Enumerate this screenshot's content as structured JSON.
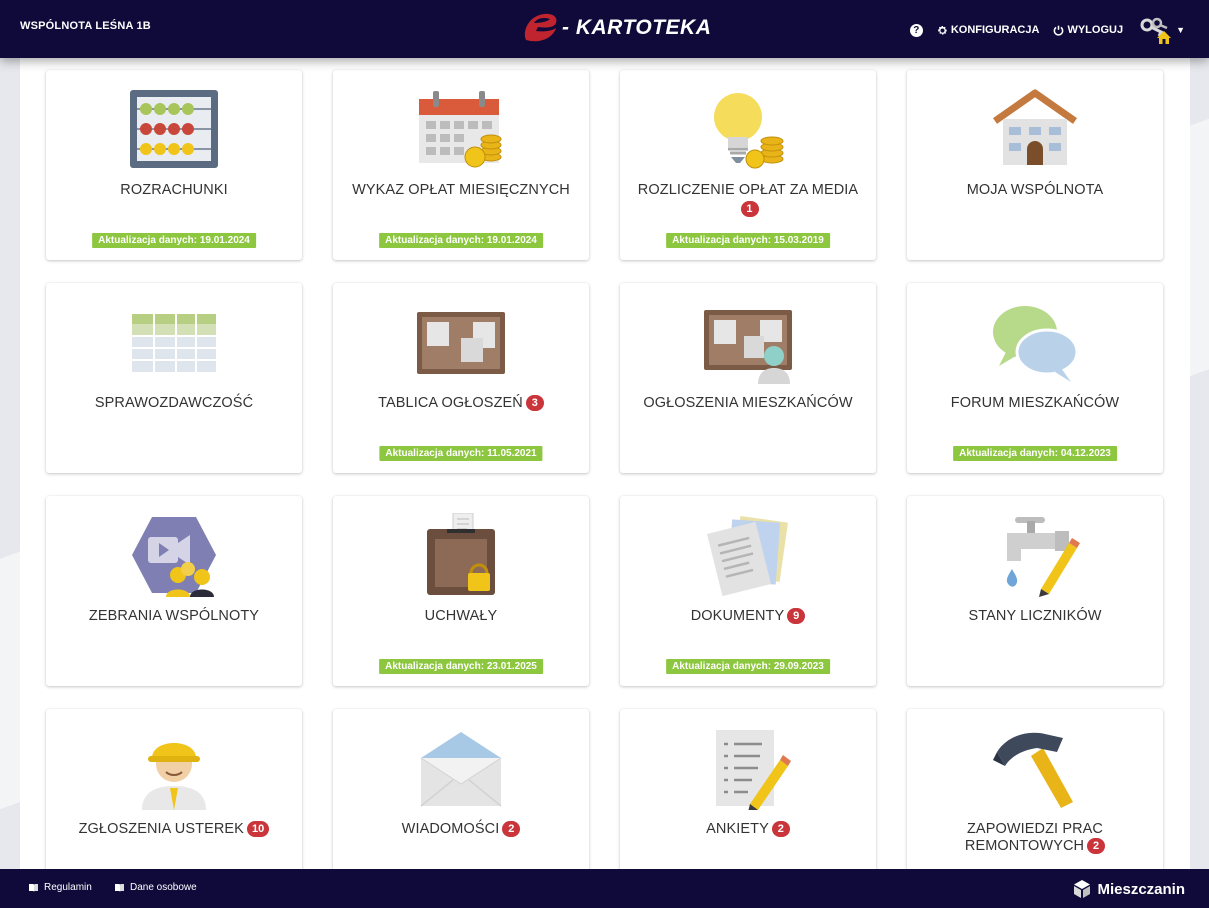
{
  "header": {
    "org_name": "WSPÓLNOTA LEŚNA 1B",
    "logo_text": "- KARTOTEKA",
    "help_label": "?",
    "config_label": "KONFIGURACJA",
    "logout_label": "WYLOGUJ"
  },
  "tiles": [
    {
      "title": "ROZRACHUNKI",
      "badge": "",
      "update": "Aktualizacja danych: 19.01.2024",
      "icon": "abacus-icon"
    },
    {
      "title": "WYKAZ OPŁAT MIESIĘCZNYCH",
      "badge": "",
      "update": "Aktualizacja danych: 19.01.2024",
      "icon": "calendar-coins-icon"
    },
    {
      "title": "ROZLICZENIE OPŁAT ZA MEDIA",
      "badge": "1",
      "update": "Aktualizacja danych: 15.03.2019",
      "icon": "lightbulb-coins-icon"
    },
    {
      "title": "MOJA WSPÓLNOTA",
      "badge": "",
      "update": "",
      "icon": "house-icon"
    },
    {
      "title": "SPRAWOZDAWCZOŚĆ",
      "badge": "",
      "update": "",
      "icon": "spreadsheet-icon"
    },
    {
      "title": "TABLICA OGŁOSZEŃ",
      "badge": "3",
      "update": "Aktualizacja danych: 11.05.2021",
      "icon": "corkboard-icon"
    },
    {
      "title": "OGŁOSZENIA MIESZKAŃCÓW",
      "badge": "",
      "update": "",
      "icon": "corkboard-person-icon"
    },
    {
      "title": "FORUM MIESZKAŃCÓW",
      "badge": "",
      "update": "Aktualizacja danych: 04.12.2023",
      "icon": "speech-bubbles-icon"
    },
    {
      "title": "ZEBRANIA WSPÓLNOTY",
      "badge": "",
      "update": "",
      "icon": "video-meeting-icon"
    },
    {
      "title": "UCHWAŁY",
      "badge": "",
      "update": "Aktualizacja danych: 23.01.2025",
      "icon": "ballot-box-icon"
    },
    {
      "title": "DOKUMENTY",
      "badge": "9",
      "update": "Aktualizacja danych: 29.09.2023",
      "icon": "documents-icon"
    },
    {
      "title": "STANY LICZNIKÓW",
      "badge": "",
      "update": "",
      "icon": "faucet-pencil-icon"
    },
    {
      "title": "ZGŁOSZENIA USTEREK",
      "badge": "10",
      "update": "",
      "icon": "worker-icon"
    },
    {
      "title": "WIADOMOŚCI",
      "badge": "2",
      "update": "",
      "icon": "envelope-icon"
    },
    {
      "title": "ANKIETY",
      "badge": "2",
      "update": "",
      "icon": "survey-icon"
    },
    {
      "title": "ZAPOWIEDZI PRAC REMONTOWYCH",
      "badge": "2",
      "update": "",
      "icon": "hammer-icon"
    }
  ],
  "footer": {
    "terms_label": "Regulamin",
    "privacy_label": "Dane osobowe",
    "brand": "Mieszczanin"
  },
  "colors": {
    "header_bg": "#0f0a3a",
    "update_badge": "#8dc63f",
    "count_badge": "#c9353b"
  }
}
